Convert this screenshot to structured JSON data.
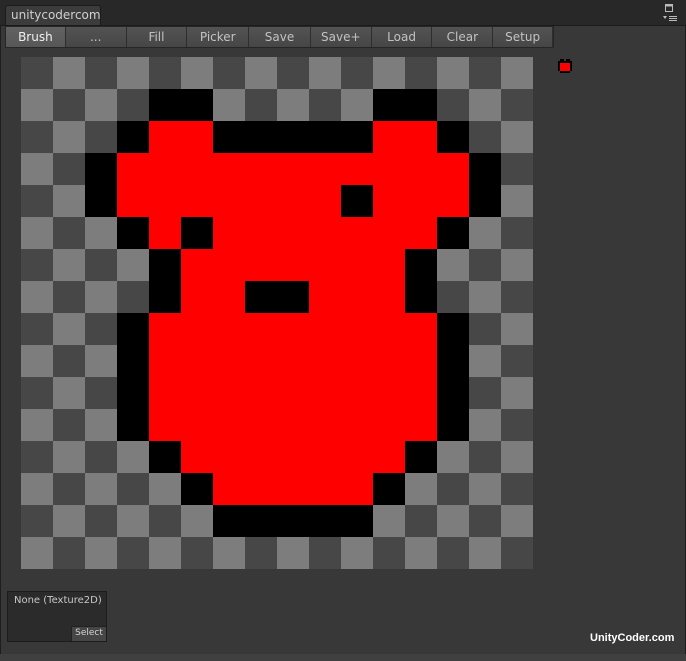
{
  "window": {
    "tab_title": "unitycodercom_",
    "menu_icon": "window-options-icon",
    "maximize_icon": "window-maximize-icon"
  },
  "toolbar": {
    "buttons": [
      {
        "label": "Brush",
        "active": true
      },
      {
        "label": "...",
        "active": false
      },
      {
        "label": "Fill",
        "active": false
      },
      {
        "label": "Picker",
        "active": false
      },
      {
        "label": "Save",
        "active": false
      },
      {
        "label": "Save+",
        "active": false
      },
      {
        "label": "Load",
        "active": false
      },
      {
        "label": "Clear",
        "active": false
      },
      {
        "label": "Setup",
        "active": false
      }
    ]
  },
  "canvas": {
    "grid_size": 16,
    "colors": {
      "checker_light": "#7d7d7d",
      "checker_dark": "#474747",
      "black": "#000000",
      "red": "#ff0000"
    },
    "pixels": [
      "................",
      "....KK.....KK...",
      "...KRRKKKKKRRK..",
      "..KRRRRRRRRRRRK.",
      "..KRRRRRRRKRRRK.",
      "...KRKRRRRRRRK..",
      "....KRRRRRRRK...",
      "....KRRKKRRRK...",
      "...KRRRRRRRRRK..",
      "...KRRRRRRRRRK..",
      "...KRRRRRRRRRK..",
      "...KRRRRRRRRRK..",
      "....KRRRRRRRK...",
      ".....KRRRRRK....",
      "......KKKKK.....",
      "................"
    ]
  },
  "preview": {
    "icon": "bear-sprite-preview-icon"
  },
  "texture_field": {
    "label": "None (Texture2D)",
    "select_label": "Select"
  },
  "watermark": "UnityCoder.com"
}
